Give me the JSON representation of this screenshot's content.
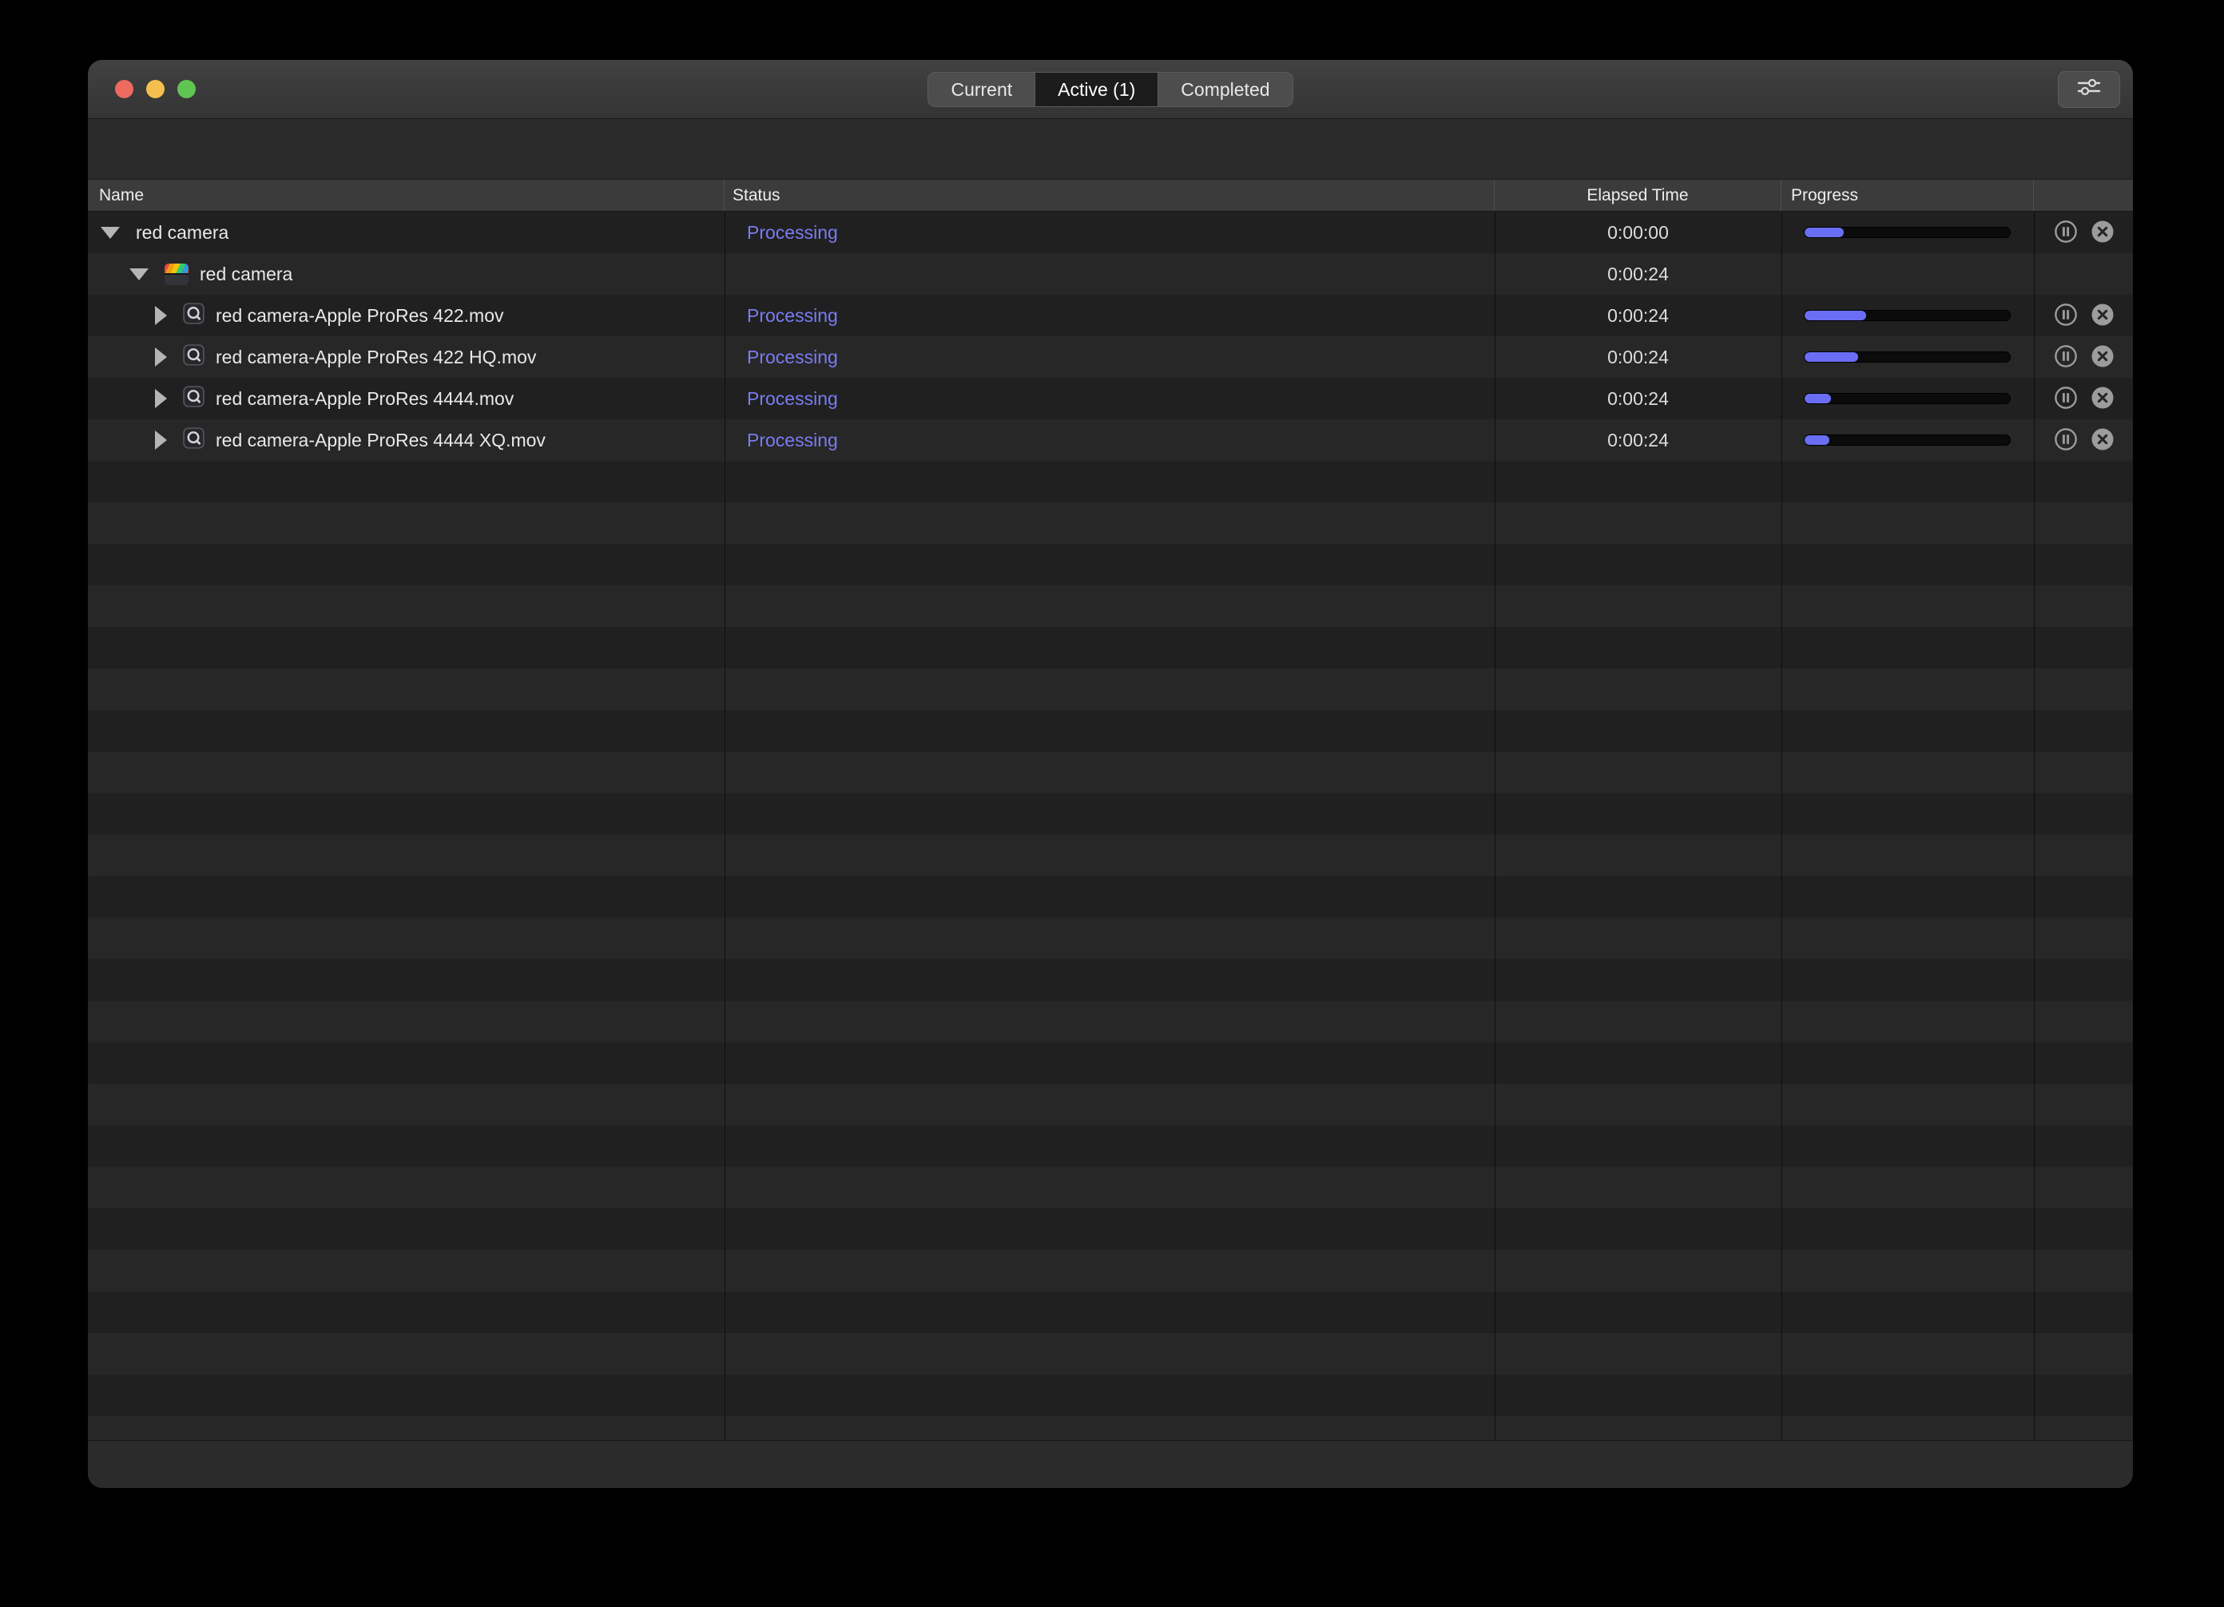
{
  "window": {
    "tabs": [
      {
        "label": "Current",
        "selected": false
      },
      {
        "label": "Active (1)",
        "selected": true
      },
      {
        "label": "Completed",
        "selected": false
      }
    ]
  },
  "colors": {
    "accent": "#6a6ef4",
    "processing_text": "#797cf2"
  },
  "table": {
    "columns": {
      "name": "Name",
      "status": "Status",
      "elapsed": "Elapsed Time",
      "progress": "Progress"
    },
    "rows": [
      {
        "indent": 0,
        "disclosure": "down",
        "icon": "none",
        "name": "red camera",
        "status": "Processing",
        "elapsed": "0:00:00",
        "progress": 19,
        "actions": true
      },
      {
        "indent": 1,
        "disclosure": "down",
        "icon": "clapper",
        "name": "red camera",
        "status": "",
        "elapsed": "0:00:24",
        "progress": null,
        "actions": false
      },
      {
        "indent": 2,
        "disclosure": "right",
        "icon": "quicktime",
        "name": "red camera-Apple ProRes 422.mov",
        "status": "Processing",
        "elapsed": "0:00:24",
        "progress": 30,
        "actions": true
      },
      {
        "indent": 2,
        "disclosure": "right",
        "icon": "quicktime",
        "name": "red camera-Apple ProRes 422 HQ.mov",
        "status": "Processing",
        "elapsed": "0:00:24",
        "progress": 26,
        "actions": true
      },
      {
        "indent": 2,
        "disclosure": "right",
        "icon": "quicktime",
        "name": "red camera-Apple ProRes 4444.mov",
        "status": "Processing",
        "elapsed": "0:00:24",
        "progress": 13,
        "actions": true
      },
      {
        "indent": 2,
        "disclosure": "right",
        "icon": "quicktime",
        "name": "red camera-Apple ProRes 4444 XQ.mov",
        "status": "Processing",
        "elapsed": "0:00:24",
        "progress": 12,
        "actions": true
      }
    ]
  }
}
